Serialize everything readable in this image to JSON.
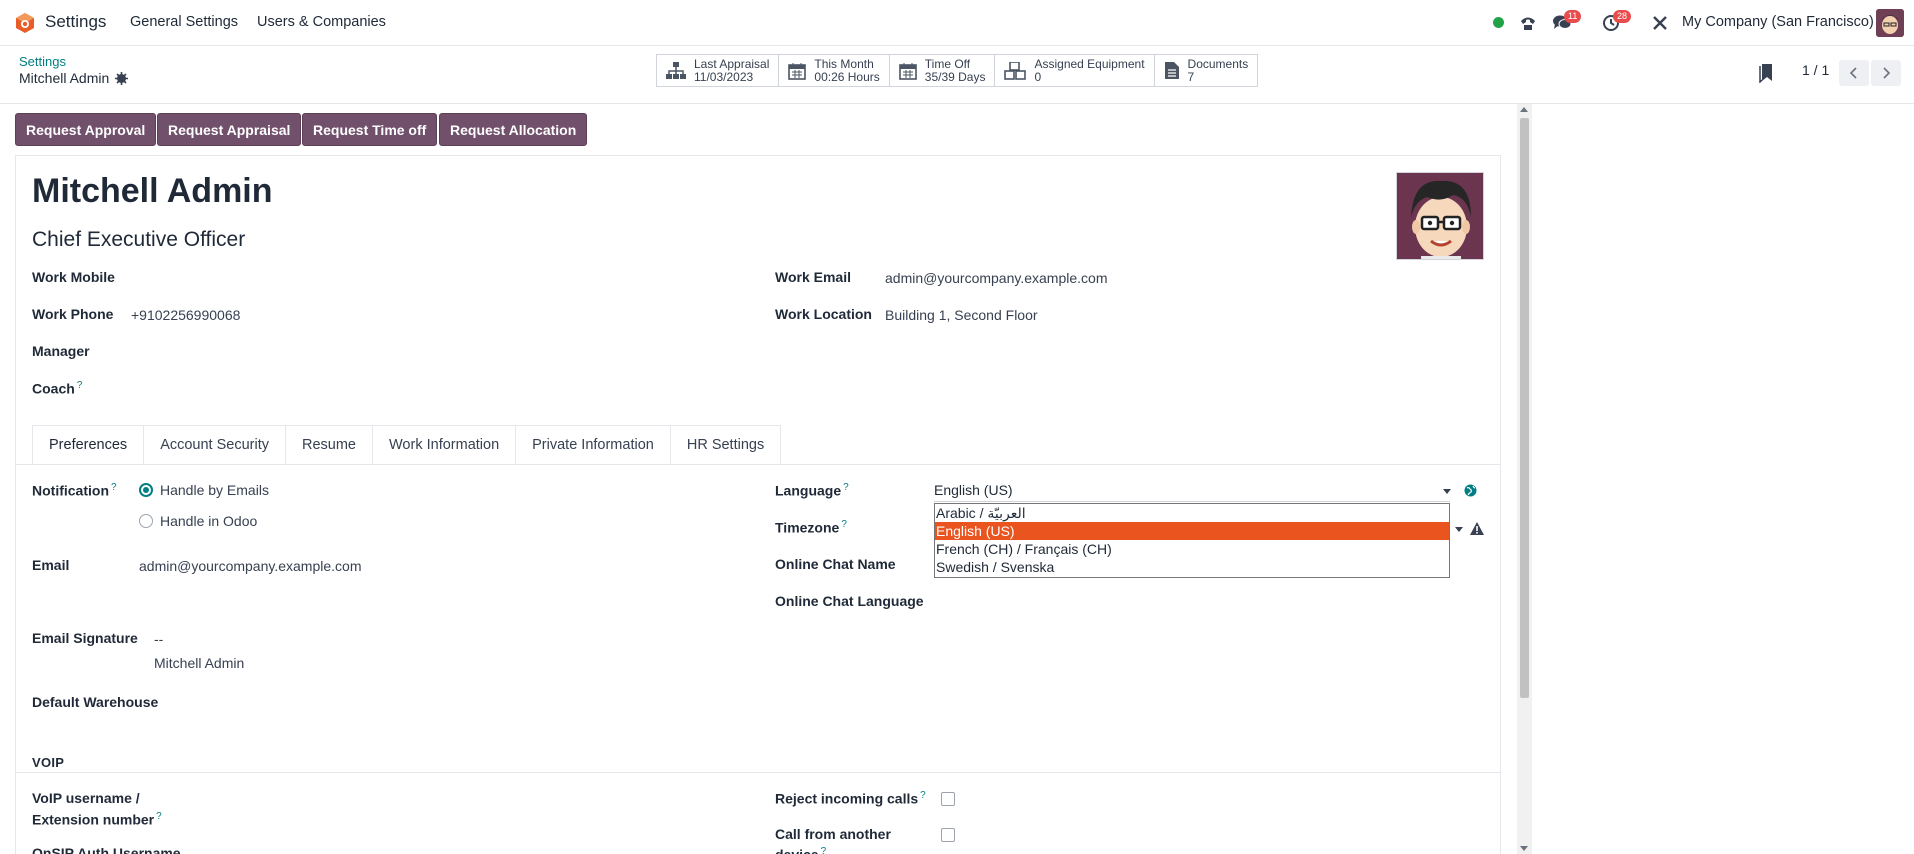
{
  "navbar": {
    "app_name": "Settings",
    "menu": [
      "General Settings",
      "Users & Companies"
    ],
    "messages_count": "11",
    "activities_count": "28",
    "company": "My Company (San Francisco)"
  },
  "breadcrumb": {
    "parent": "Settings",
    "current": "Mitchell Admin"
  },
  "smart_buttons": [
    {
      "label": "Last Appraisal",
      "value": "11/03/2023",
      "icon": "org-chart-icon"
    },
    {
      "label": "This Month",
      "value": "00:26 Hours",
      "icon": "calendar-icon"
    },
    {
      "label": "Time Off",
      "value": "35/39 Days",
      "icon": "calendar-icon"
    },
    {
      "label": "Assigned Equipment",
      "value": "0",
      "icon": "cubes-icon"
    },
    {
      "label": "Documents",
      "value": "7",
      "icon": "document-icon"
    }
  ],
  "pager": "1 / 1",
  "status_buttons": [
    "Request Approval",
    "Request Appraisal",
    "Request Time off",
    "Request Allocation"
  ],
  "employee": {
    "name": "Mitchell Admin",
    "job_title": "Chief Executive Officer"
  },
  "fields": {
    "work_mobile_label": "Work Mobile",
    "work_phone_label": "Work Phone",
    "work_phone": "+9102256990068",
    "manager_label": "Manager",
    "coach_label": "Coach",
    "work_email_label": "Work Email",
    "work_email": "admin@yourcompany.example.com",
    "work_location_label": "Work Location",
    "work_location": "Building 1, Second Floor"
  },
  "tabs": [
    "Preferences",
    "Account Security",
    "Resume",
    "Work Information",
    "Private Information",
    "HR Settings"
  ],
  "preferences": {
    "notification_label": "Notification",
    "notification_options": [
      "Handle by Emails",
      "Handle in Odoo"
    ],
    "email_label": "Email",
    "email": "admin@yourcompany.example.com",
    "signature_label": "Email Signature",
    "signature_dashes": "--",
    "signature_name": "Mitchell Admin",
    "warehouse_label": "Default Warehouse",
    "language_label": "Language",
    "language_value": "English (US)",
    "timezone_label": "Timezone",
    "chat_name_label": "Online Chat Name",
    "chat_language_label": "Online Chat Language",
    "language_options": [
      "Arabic / العربيّة",
      "English (US)",
      "French (CH) / Français (CH)",
      "Swedish / Svenska"
    ]
  },
  "voip": {
    "section_title": "VOIP",
    "username_label_1": "VoIP username /",
    "username_label_2": "Extension number",
    "onsip_label": "OnSIP Auth Username",
    "reject_label": "Reject incoming calls",
    "call_other_label_1": "Call from another",
    "call_other_label_2": "device"
  }
}
